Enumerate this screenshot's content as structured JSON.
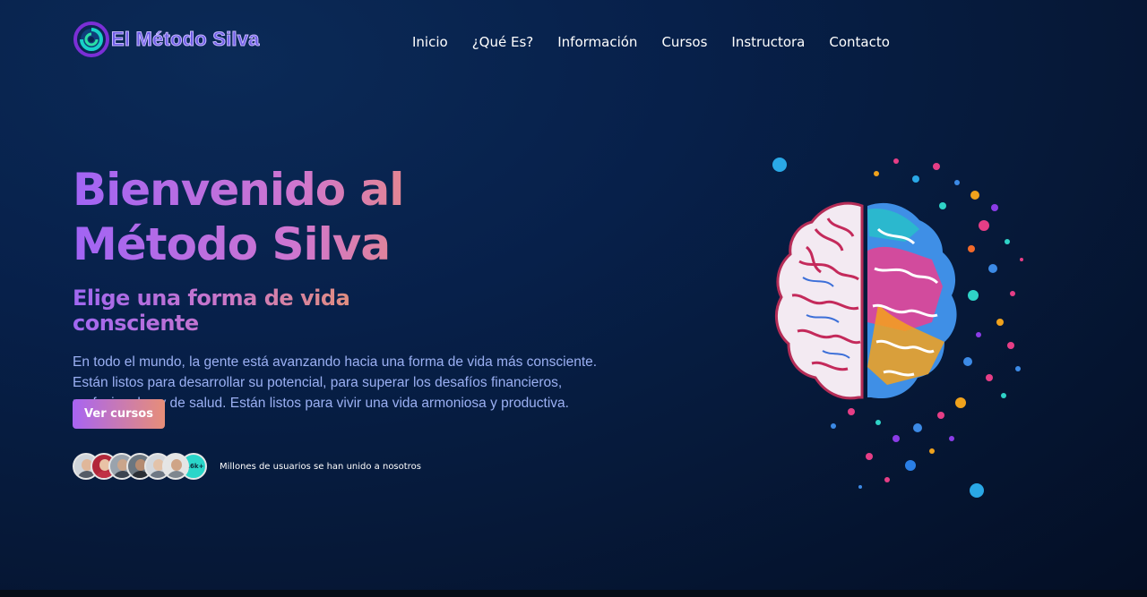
{
  "brand": {
    "name": "El Método Silva"
  },
  "nav": [
    {
      "label": "Inicio"
    },
    {
      "label": "¿Qué Es?"
    },
    {
      "label": "Información"
    },
    {
      "label": "Cursos"
    },
    {
      "label": "Instructora"
    },
    {
      "label": "Contacto"
    }
  ],
  "hero": {
    "title": "Bienvenido al Método Silva",
    "subtitle": "Elige una forma de vida consciente",
    "description": "En todo el mundo, la gente está avanzando hacia una forma de vida más consciente. Están listos para desarrollar su potencial, para superar los desafíos financieros, profesionales y de salud. Están listos para vivir una vida armoniosa y productiva.",
    "cta_label": "Ver cursos"
  },
  "social_proof": {
    "count": "1.6k+",
    "text": "Millones de usuarios se han unido a nosotros"
  },
  "colors": {
    "accent_start": "#a864f2",
    "accent_end": "#e78e78",
    "background": "#07204a",
    "badge": "#2ad6c9"
  },
  "icons": [
    "logo-swirl-icon",
    "brain-illustration"
  ]
}
